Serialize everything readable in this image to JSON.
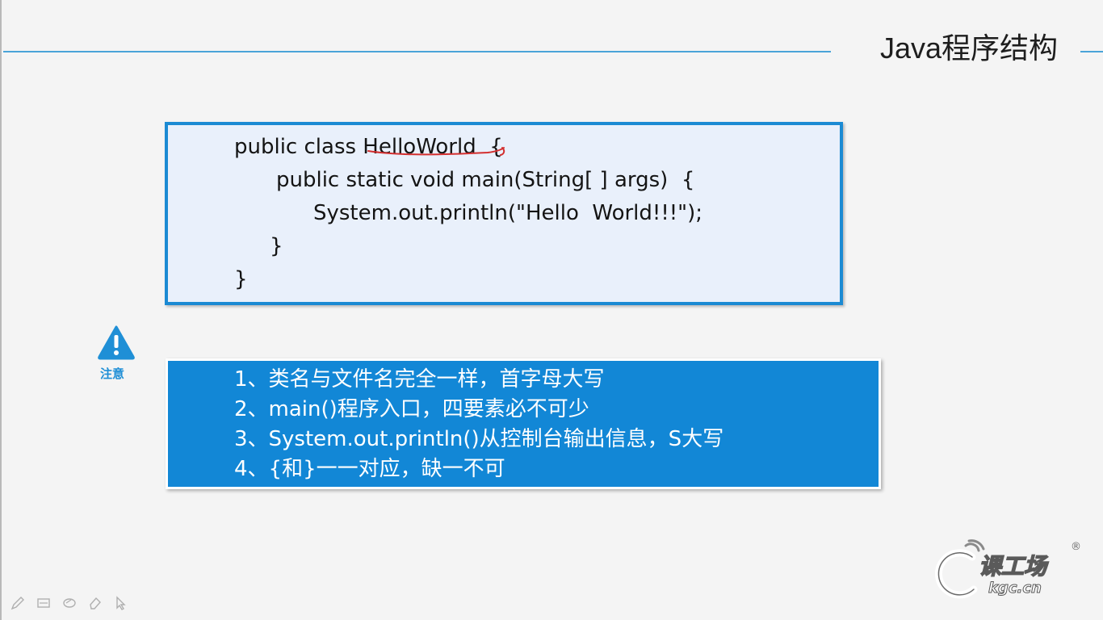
{
  "slide": {
    "title": "Java程序结构"
  },
  "code": {
    "lines": [
      "public class HelloWorld  {",
      "public static void main(String[ ] args)  {",
      "System.out.println(\"Hello  World!!!\");",
      "}",
      "}"
    ]
  },
  "notice": {
    "icon": "warning-icon",
    "label": "注意"
  },
  "notes": {
    "items": [
      "1、类名与文件名完全一样，首字母大写",
      "2、main()程序入口，四要素必不可少",
      "3、System.out.println()从控制台输出信息，S大写",
      "4、{和}一一对应，缺一不可"
    ]
  },
  "toolbar": {
    "tools": [
      "pen-icon",
      "highlighter-icon",
      "eraser-icon",
      "clear-icon",
      "pointer-icon"
    ]
  },
  "logo": {
    "text": "课工场",
    "sub": "kgc.cn",
    "registered": "®"
  },
  "colors": {
    "accent": "#1287d6",
    "rule": "#4aa4d8",
    "code_bg": "#e9f0fb",
    "code_border": "#1b8ad3",
    "underline": "#d32f2f"
  }
}
